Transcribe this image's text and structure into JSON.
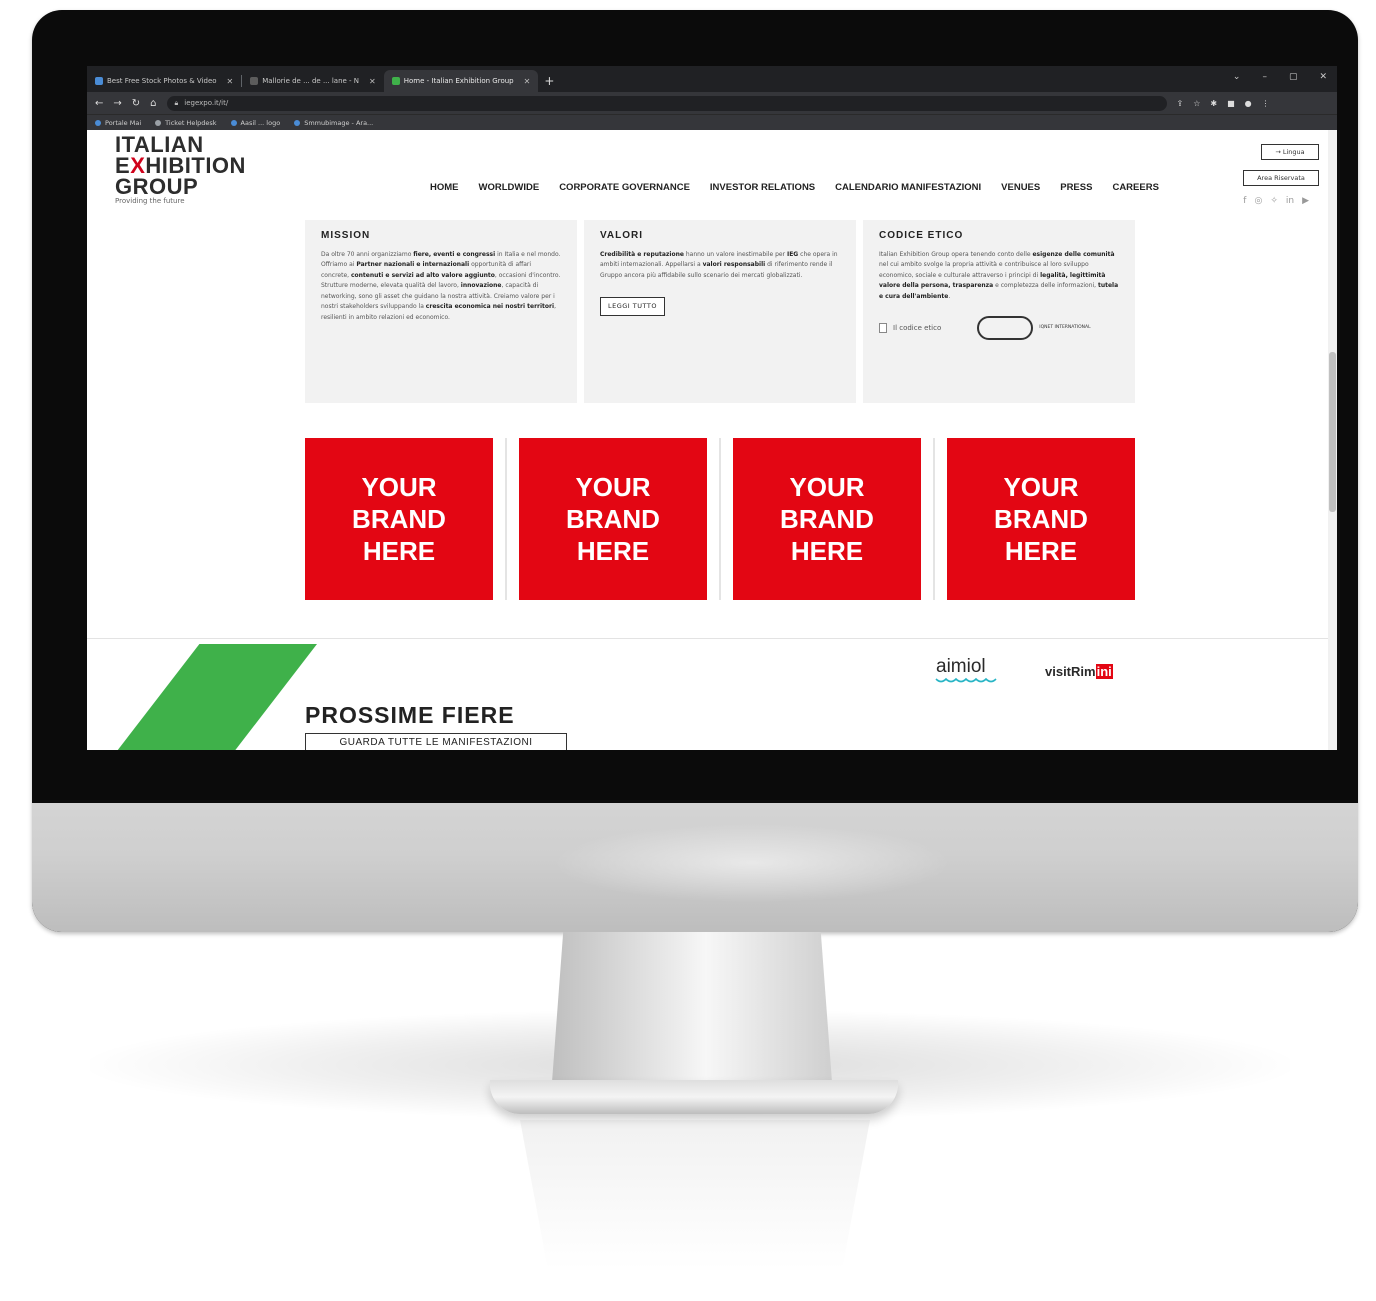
{
  "tabs": [
    {
      "label": "Best Free Stock Photos & Video",
      "fav_color": "#4a8cd6",
      "active": false
    },
    {
      "label": "Mallorie de ... de ... lane - N",
      "fav_color": "#5c5c5c",
      "active": false
    },
    {
      "label": "Home - Italian Exhibition Group",
      "fav_color": "#3fb14a",
      "active": true
    }
  ],
  "address": {
    "url": "iegexpo.it/it/"
  },
  "bookmarks": [
    {
      "label": "Portale Mai",
      "color": "#4a8cd6"
    },
    {
      "label": "Ticket Helpdesk",
      "color": "#9aa0a6"
    },
    {
      "label": "Aasil ... logo",
      "color": "#4a8cd6"
    },
    {
      "label": "Smmubimage - Ara...",
      "color": "#4a8cd6"
    }
  ],
  "logo": {
    "line1": "ITALIAN",
    "line2_a": "E",
    "line2_x": "X",
    "line2_b": "HIBITION",
    "line3": "GROUP",
    "tagline": "Providing the future"
  },
  "nav": [
    "HOME",
    "WORLDWIDE",
    "CORPORATE GOVERNANCE",
    "INVESTOR RELATIONS",
    "CALENDARIO MANIFESTAZIONI",
    "VENUES",
    "PRESS",
    "CAREERS"
  ],
  "header_buttons": {
    "lang": "→ Lingua",
    "area": "Area Riservata"
  },
  "socials": [
    "f",
    "◎",
    "✧",
    "in",
    "▶"
  ],
  "cards": {
    "mission": {
      "title": "MISSION",
      "p1": "Da oltre 70 anni organizziamo ",
      "b1": "fiere, eventi e congressi",
      "p2": " in Italia e nel mondo. Offriamo ai ",
      "b2": "Partner nazionali e internazionali",
      "p3": " opportunità di affari concrete, ",
      "b3": "contenuti e servizi ad alto valore aggiunto",
      "p4": ", occasioni d'incontro. Strutture moderne, elevata qualità del lavoro, ",
      "b4": "innovazione",
      "p5": ", capacità di networking, sono gli asset che guidano la nostra attività. Creiamo valore per i nostri stakeholders sviluppando la ",
      "b5": "crescita economica nei nostri territori",
      "p6": ", resilienti in ambito relazioni ed economico."
    },
    "valori": {
      "title": "VALORI",
      "b1": "Credibilità e reputazione",
      "p1": " hanno un valore inestimabile per ",
      "b2": "IEG",
      "p2": " che opera in ambiti internazionali. Appellarsi a ",
      "b3": "valori responsabili",
      "p3": " di riferimento rende il Gruppo ancora più affidabile sullo scenario dei mercati globalizzati.",
      "button": "LEGGI TUTTO"
    },
    "codice": {
      "title": "CODICE ETICO",
      "p1": "Italian Exhibition Group opera tenendo conto delle ",
      "b1": "esigenze delle comunità",
      "p2": " nel cui ambito svolge la propria attività e contribuisce al loro sviluppo economico, sociale e culturale attraverso i principi di ",
      "b2": "legalità, legittimità valore della persona, trasparenza",
      "p3": " e completezza delle informazioni, ",
      "b3": "tutela e cura dell'ambiente",
      "p4": ".",
      "link": "Il codice etico",
      "cert": "IQNET INTERNATIONAL"
    }
  },
  "brand_tiles": [
    {
      "line1": "YOUR",
      "line2": "BRAND",
      "line3": "HERE"
    },
    {
      "line1": "YOUR",
      "line2": "BRAND",
      "line3": "HERE"
    },
    {
      "line1": "YOUR",
      "line2": "BRAND",
      "line3": "HERE"
    },
    {
      "line1": "YOUR",
      "line2": "BRAND",
      "line3": "HERE"
    }
  ],
  "fairs": {
    "title": "PROSSIME FIERE",
    "button": "GUARDA TUTTE LE MANIFESTAZIONI"
  },
  "partners": {
    "logo1": "aimiol",
    "logo2_a": "visitRim",
    "logo2_b": "ini"
  },
  "colors": {
    "brand_red": "#e30613",
    "accent_green": "#3fb14a",
    "card_bg": "#f2f2f2"
  }
}
